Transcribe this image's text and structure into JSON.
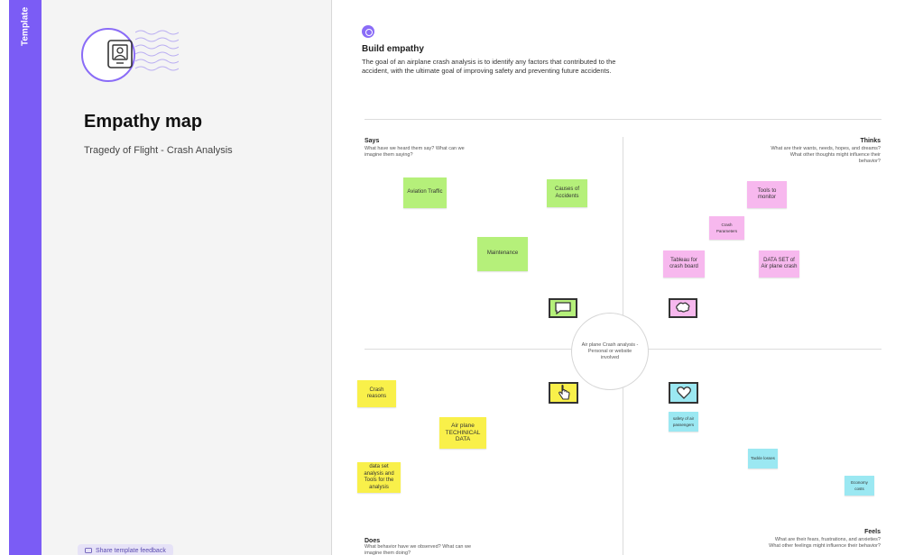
{
  "sidebar": {
    "strip_label": "Template",
    "title": "Empathy map",
    "subtitle": "Tragedy of Flight - Crash Analysis",
    "feedback_label": "Share template feedback"
  },
  "canvas": {
    "header_title": "Build empathy",
    "header_desc": "The goal of an airplane crash analysis is to identify any factors that contributed to the accident, with the ultimate goal of improving safety and preventing future accidents.",
    "center_text": "Air plane Crash analysis - Personal or website involved",
    "quadrants": {
      "says": {
        "title": "Says",
        "desc": "What have we heard them say? What can we imagine them saying?"
      },
      "thinks": {
        "title": "Thinks",
        "desc": "What are their wants, needs, hopes, and dreams? What other thoughts might influence their behavior?"
      },
      "does": {
        "title": "Does",
        "desc": "What behavior have we observed? What can we imagine them doing?"
      },
      "feels": {
        "title": "Feels",
        "desc": "What are their fears, frustrations, and anxieties? What other feelings might influence their behavior?"
      }
    },
    "stickies": {
      "says": [
        "Aviation Traffic",
        "Causes of Accidents",
        "Maintenance"
      ],
      "thinks": [
        "Tools to monitor",
        "Crash Parameters",
        "Tableau for crash board",
        "DATA SET of Air plane crash"
      ],
      "does": [
        "Crash reasons",
        "Air plane TECHINICAL DATA",
        "data set analysis and Tools for the analysis"
      ],
      "feels": [
        "safety of air passengers",
        "Tackle losses",
        "Economy costs"
      ]
    },
    "icons": {
      "says": "speech-bubble-icon",
      "thinks": "thought-bubble-icon",
      "does": "pointing-hand-icon",
      "feels": "heart-icon"
    },
    "colors": {
      "accent": "#7b5cf5",
      "says_sticky": "#b5f07a",
      "thinks_sticky": "#f7b8ee",
      "does_sticky": "#f9f04a",
      "feels_sticky": "#9be8f2"
    }
  }
}
